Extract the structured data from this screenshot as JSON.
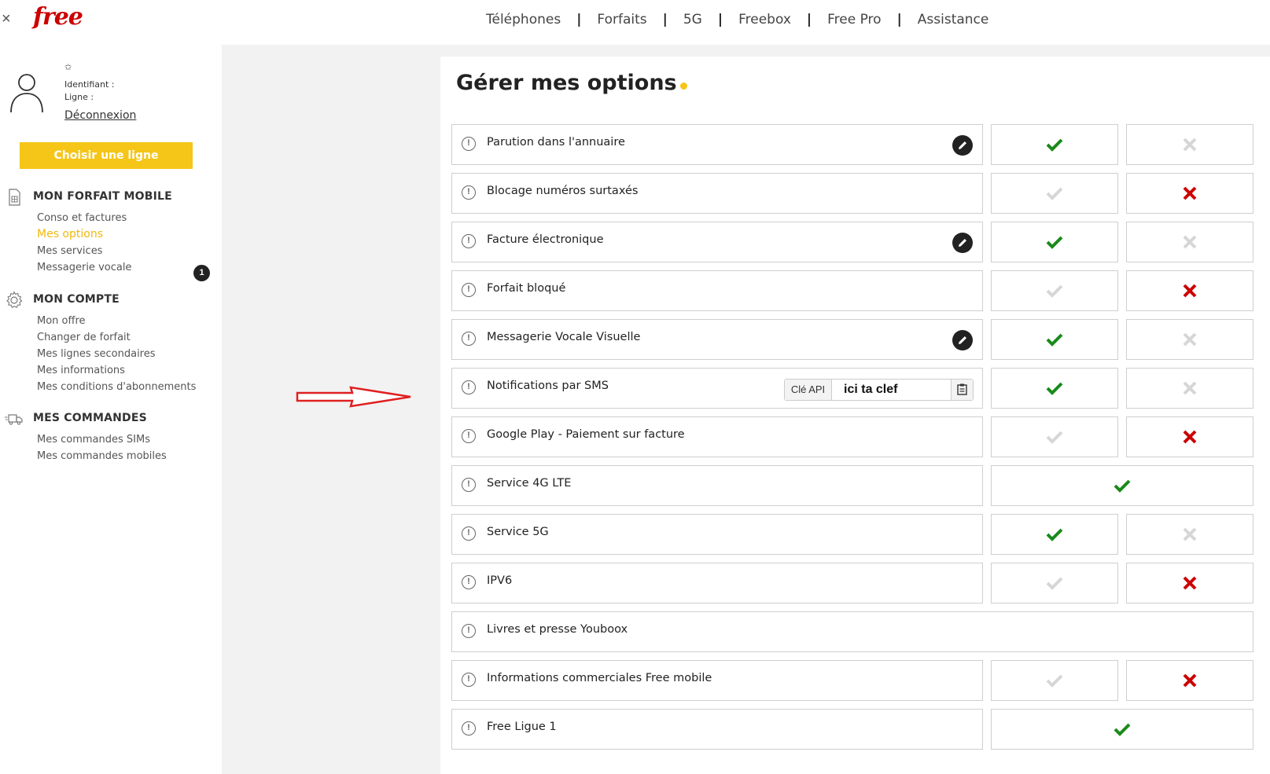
{
  "header": {
    "logo": "free",
    "close_glyph": "×",
    "nav": [
      "Téléphones",
      "Forfaits",
      "5G",
      "Freebox",
      "Free Pro",
      "Assistance"
    ],
    "separator": "|"
  },
  "user": {
    "small_icon_glyph": "✩",
    "identifiant_label": "Identifiant :",
    "ligne_label": "Ligne :",
    "logout": "Déconnexion",
    "choose_line": "Choisir une ligne"
  },
  "sidebar": {
    "forfait": {
      "title": "MON FORFAIT MOBILE",
      "links": [
        "Conso et factures",
        "Mes options",
        "Mes services",
        "Messagerie vocale"
      ],
      "active_index": 1,
      "badge": "1"
    },
    "compte": {
      "title": "MON COMPTE",
      "links": [
        "Mon offre",
        "Changer de forfait",
        "Mes lignes secondaires",
        "Mes informations",
        "Mes conditions d'abonnements"
      ]
    },
    "commandes": {
      "title": "MES COMMANDES",
      "links": [
        "Mes commandes SIMs",
        "Mes commandes mobiles"
      ]
    }
  },
  "main": {
    "title_light": "Gérer ",
    "title_bold": "mes options",
    "info_glyph": "!",
    "api": {
      "label": "Clé API",
      "value": "ici ta clef"
    },
    "options": [
      {
        "label": "Parution dans l'annuaire",
        "edit": true,
        "state": "yes"
      },
      {
        "label": "Blocage numéros surtaxés",
        "edit": false,
        "state": "no"
      },
      {
        "label": "Facture électronique",
        "edit": true,
        "state": "yes"
      },
      {
        "label": "Forfait bloqué",
        "edit": false,
        "state": "no"
      },
      {
        "label": "Messagerie Vocale Visuelle",
        "edit": true,
        "state": "yes"
      },
      {
        "label": "Notifications par SMS",
        "edit": false,
        "state": "yes",
        "api": true
      },
      {
        "label": "Google Play - Paiement sur facture",
        "edit": false,
        "state": "no"
      },
      {
        "label": "Service 4G LTE",
        "edit": false,
        "state": "full"
      },
      {
        "label": "Service 5G",
        "edit": false,
        "state": "yes"
      },
      {
        "label": "IPV6",
        "edit": false,
        "state": "no"
      },
      {
        "label": "Livres et presse Youboox",
        "edit": false,
        "state": "none"
      },
      {
        "label": "Informations commerciales Free mobile",
        "edit": false,
        "state": "no"
      },
      {
        "label": "Free Ligue 1",
        "edit": false,
        "state": "full"
      }
    ]
  },
  "colors": {
    "accent": "#f5c518",
    "check_active": "#1a8a1a",
    "cross_active": "#cc0000",
    "inactive": "#d6d6d6",
    "arrow": "#e02020"
  }
}
